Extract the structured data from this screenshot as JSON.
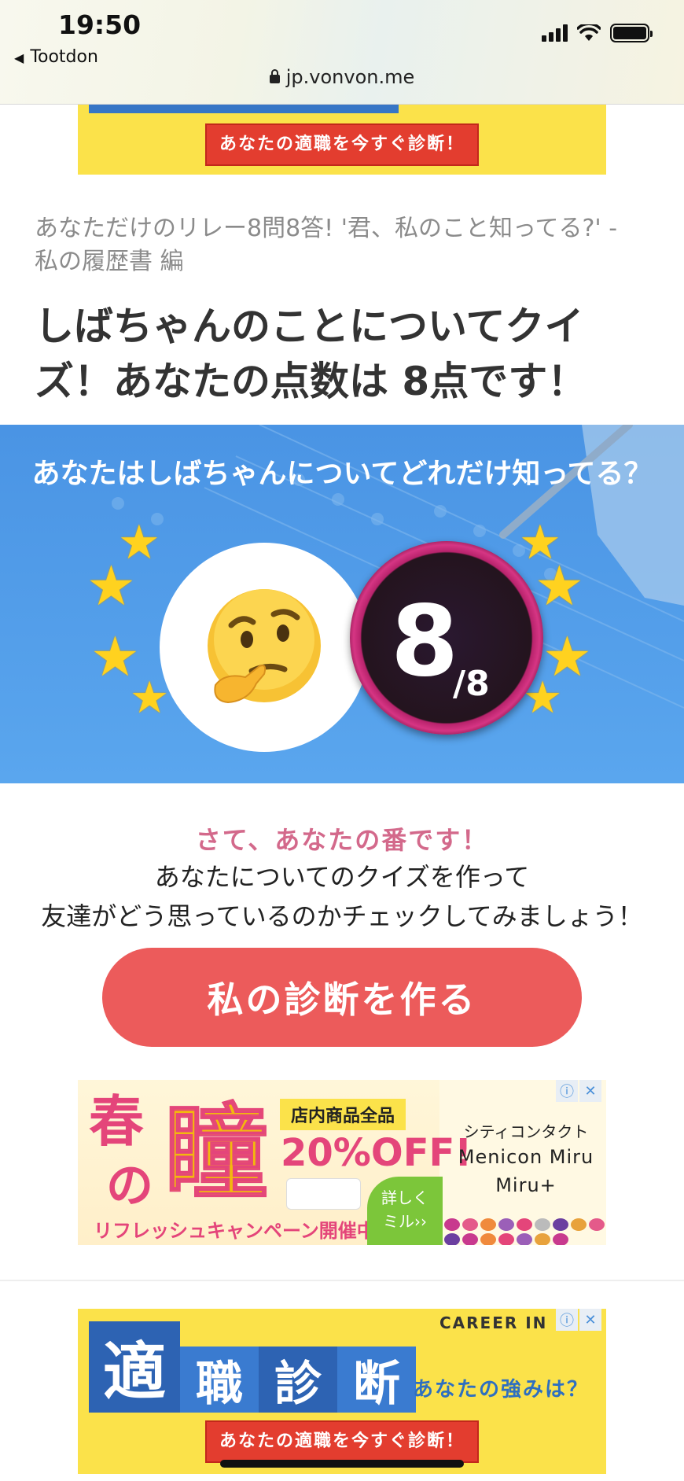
{
  "status_bar": {
    "time": "19:50",
    "back_app": "Tootdon",
    "url": "jp.vonvon.me"
  },
  "top_ad": {
    "cta": "あなたの適職を今すぐ診断！"
  },
  "article": {
    "subtitle": "あなただけのリレー8問8答! '君、私のこと知ってる?' - 私の履歴書 編",
    "title": "しばちゃんのことについてクイズ！あなたの点数は 8点です！"
  },
  "result": {
    "question": "あなたはしばちゃんについてどれだけ知ってる？",
    "emoji": "🤔",
    "score": "8",
    "total": "/8"
  },
  "cta_section": {
    "turn_text": "さて、あなたの番です！",
    "desc_line1": "あなたについてのクイズを作って",
    "desc_line2": "友達がどう思っているのかチェックしてみましょう！",
    "button": "私の診断を作る"
  },
  "mid_ad": {
    "haru": "春",
    "no": "の",
    "hitomi": "瞳",
    "sale_label": "店内商品全品",
    "sale_pct": "20%OFF!",
    "campaign": "リフレッシュキャンペーン開催中!!",
    "detail": "詳しく\nミル››",
    "brand_sub": "シティコンタクト",
    "brand_name": "Menicon Miru Miru+",
    "info_icon": "ⓘ",
    "close_icon": "✕"
  },
  "bottom_ad": {
    "kanji": [
      "適",
      "職",
      "診",
      "断"
    ],
    "career": "CAREER IN",
    "strength": "あなたの強みは？",
    "cta": "あなたの適職を今すぐ診断！",
    "info_icon": "ⓘ",
    "close_icon": "✕"
  },
  "colors": {
    "accent_red": "#ec5b5b",
    "pink_text": "#d3698b",
    "banner_blue": "#4a94e4",
    "ad_yellow": "#fbe24a"
  }
}
